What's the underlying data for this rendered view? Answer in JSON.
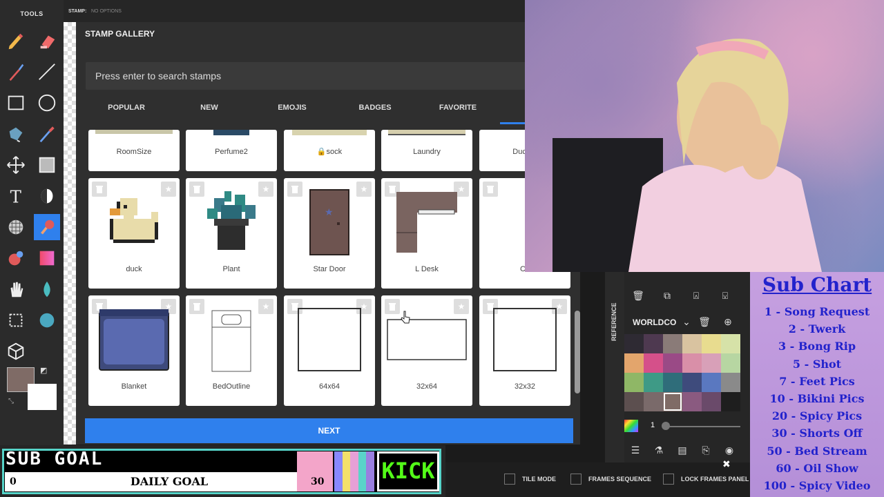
{
  "tools": {
    "title": "TOOLS",
    "items": [
      {
        "name": "pencil-icon",
        "icon": "pencil"
      },
      {
        "name": "eraser-icon",
        "icon": "eraser"
      },
      {
        "name": "brush-icon",
        "icon": "brush"
      },
      {
        "name": "line-icon",
        "icon": "line"
      },
      {
        "name": "rectangle-icon",
        "icon": "rect"
      },
      {
        "name": "ellipse-icon",
        "icon": "ellipse"
      },
      {
        "name": "bucket-icon",
        "icon": "bucket"
      },
      {
        "name": "eyedropper-icon",
        "icon": "eyedropper"
      },
      {
        "name": "move-icon",
        "icon": "move"
      },
      {
        "name": "select-icon",
        "icon": "select"
      },
      {
        "name": "text-icon",
        "icon": "text"
      },
      {
        "name": "contrast-icon",
        "icon": "contrast"
      },
      {
        "name": "pattern-icon",
        "icon": "pattern"
      },
      {
        "name": "stamp-icon",
        "icon": "stamp"
      },
      {
        "name": "mixer-icon",
        "icon": "mixer"
      },
      {
        "name": "gradient-icon",
        "icon": "gradient"
      },
      {
        "name": "hand-icon",
        "icon": "hand"
      },
      {
        "name": "drop-icon",
        "icon": "drop"
      },
      {
        "name": "crop-icon",
        "icon": "crop"
      },
      {
        "name": "blob-icon",
        "icon": "blob"
      },
      {
        "name": "cube-icon",
        "icon": "cube"
      }
    ],
    "primary_color": "#7f6b66",
    "secondary_color": "#ffffff"
  },
  "stampbar": {
    "label": "STAMP:",
    "options": "NO OPTIONS"
  },
  "gallery": {
    "title": "STAMP GALLERY",
    "search_placeholder": "Press enter to search stamps",
    "tabs": [
      "POPULAR",
      "NEW",
      "EMOJIS",
      "BADGES",
      "FAVORITE"
    ],
    "top_row": [
      "RoomSize",
      "Perfume2",
      "🔒sock",
      "Laundry",
      "Duck P"
    ],
    "row2": [
      "duck",
      "Plant",
      "Star Door",
      "L Desk",
      "Ch"
    ],
    "row3": [
      "Blanket",
      "BedOutline",
      "64x64",
      "32x64",
      "32x32"
    ],
    "next_label": "NEXT",
    "accent": "#2f80ed"
  },
  "right_panel": {
    "reference_label": "REFERENCE",
    "palette_name": "WORLDCO",
    "palette": [
      "#2e2a33",
      "#4e3950",
      "#8a7b78",
      "#d9c3a0",
      "#e8dc8f",
      "#d6e2a8",
      "#e3a56c",
      "#d5508a",
      "#9a4a86",
      "#d98fa8",
      "#d8a0b8",
      "#b7d6a2",
      "#8fb766",
      "#3e9a86",
      "#2f6d7a",
      "#3e4b7c",
      "#5a78c0",
      "#8a8a8a",
      "#5c4f4f",
      "#7a6a6a",
      "#7f6b66",
      "#8a5a80",
      "#6a4a6a",
      "#1e1e1e"
    ],
    "selected_index": 20,
    "brush_size": "1"
  },
  "sub_chart": {
    "title": "Sub Chart",
    "items": [
      "1 - Song Request",
      "2 - Twerk",
      "3 - Bong Rip",
      "5 - Shot",
      "7 - Feet Pics",
      "10 - Bikini Pics",
      "20 - Spicy Pics",
      "30 - Shorts Off",
      "50 - Bed Stream",
      "60 - Oil Show",
      "100 - Spicy Video"
    ]
  },
  "sub_goal": {
    "title": "SUB GOAL",
    "current": "0",
    "label": "DAILY GOAL",
    "target": "30",
    "badge": "KICK",
    "progress": 0,
    "stripes": [
      "#8888ff",
      "#f3e06a",
      "#e6a0d6",
      "#5ad4c9",
      "#9a7fe0"
    ]
  },
  "bottom_bar": {
    "tile_mode": "TILE MODE",
    "frames_sequence": "FRAMES SEQUENCE",
    "lock_frames": "LOCK FRAMES PANEL"
  }
}
